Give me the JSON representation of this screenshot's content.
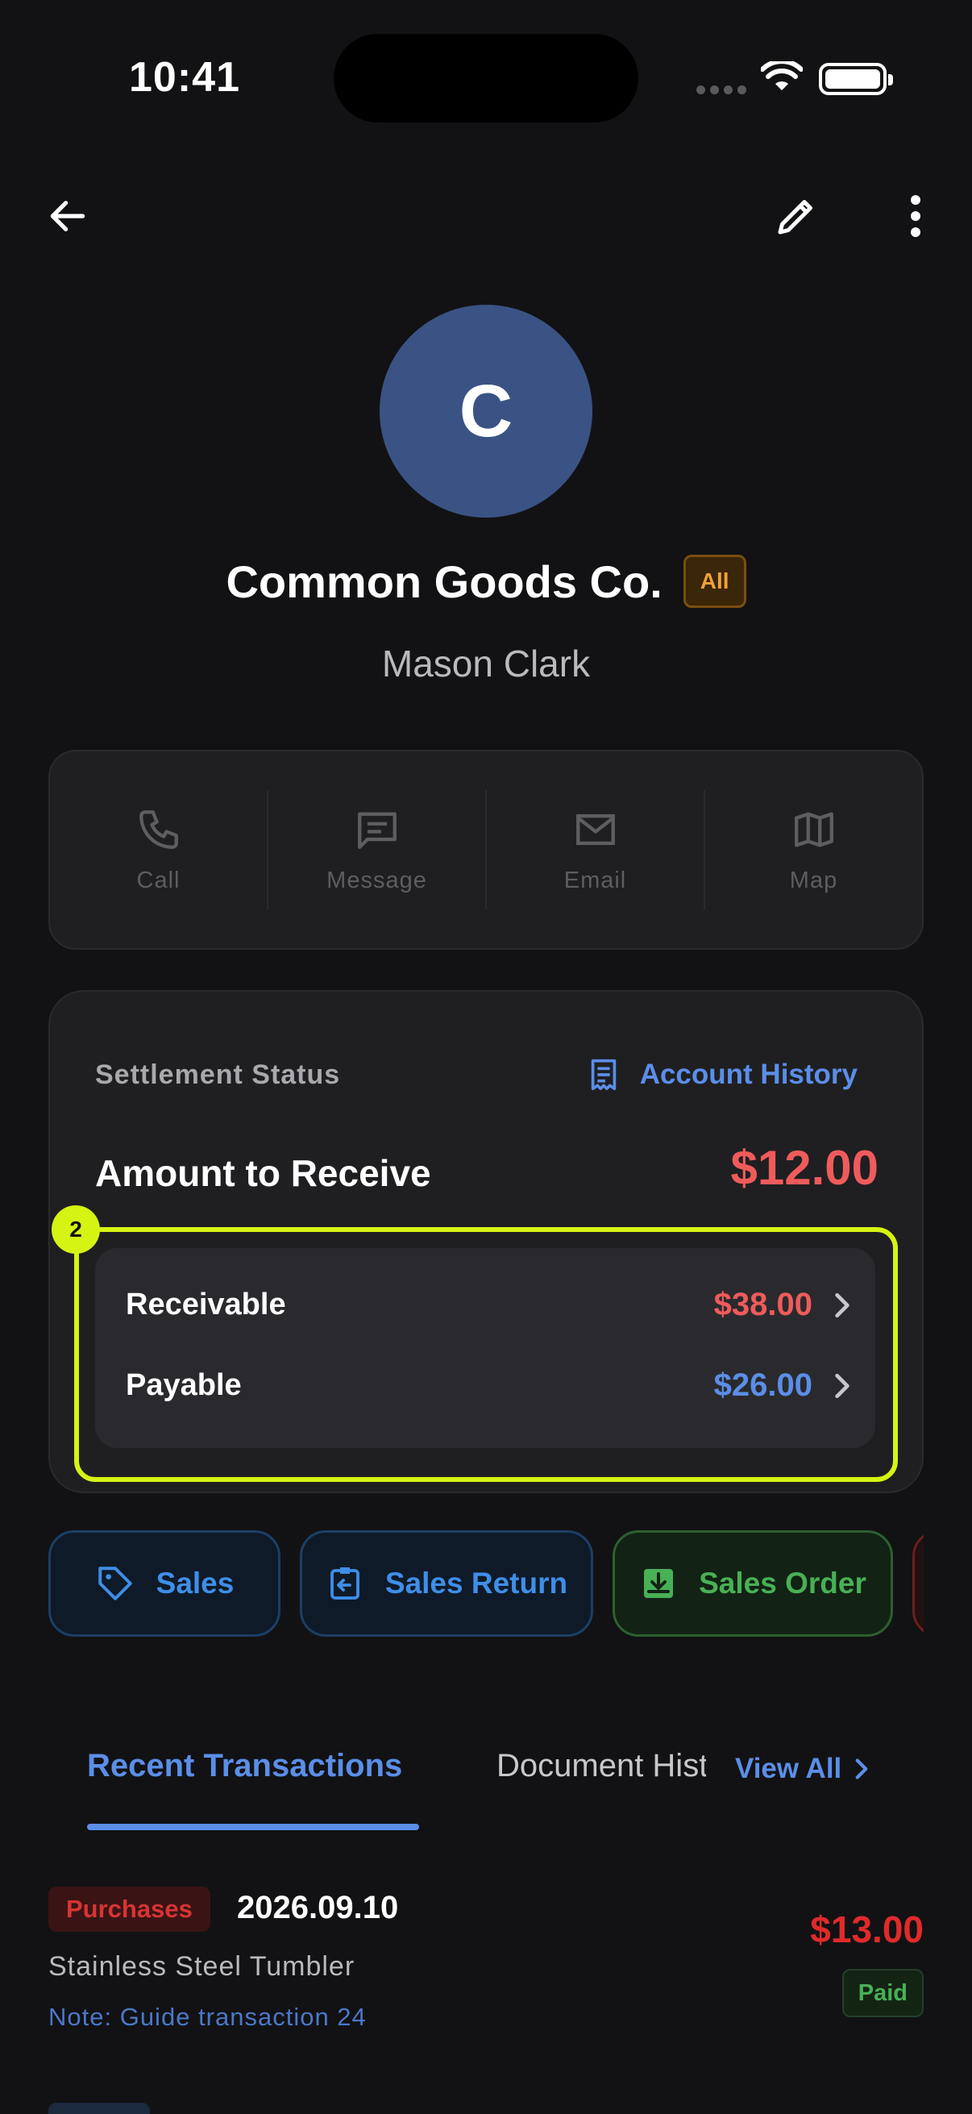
{
  "status_bar": {
    "time": "10:41"
  },
  "header": {
    "back_icon": "arrow-left-icon",
    "edit_icon": "pencil-icon",
    "more_icon": "more-vertical-icon"
  },
  "profile": {
    "avatar_initial": "C",
    "company_name": "Common Goods Co.",
    "badge": "All",
    "contact_name": "Mason Clark"
  },
  "quick_actions": [
    {
      "label": "Call",
      "icon": "phone-icon"
    },
    {
      "label": "Message",
      "icon": "message-icon"
    },
    {
      "label": "Email",
      "icon": "mail-icon"
    },
    {
      "label": "Map",
      "icon": "map-icon"
    }
  ],
  "settlement": {
    "label": "Settlement Status",
    "account_history": "Account History",
    "amount_label": "Amount to Receive",
    "amount_value": "$12.00",
    "receivable_label": "Receivable",
    "receivable_value": "$38.00",
    "payable_label": "Payable",
    "payable_value": "$26.00",
    "highlight_badge": "2"
  },
  "doc_chips": [
    {
      "label": "Sales",
      "icon": "tag-icon"
    },
    {
      "label": "Sales Return",
      "icon": "return-icon"
    },
    {
      "label": "Sales Order",
      "icon": "download-box-icon"
    }
  ],
  "tabs": {
    "recent": "Recent Transactions",
    "document": "Document History",
    "view_all": "View All"
  },
  "transaction": {
    "type": "Purchases",
    "date": "2026.09.10",
    "amount": "$13.00",
    "item": "Stainless Steel Tumbler",
    "note": "Note: Guide transaction 24",
    "status": "Paid"
  },
  "colors": {
    "accent_blue": "#5b8ee8",
    "negative_red": "#ef5b5b",
    "highlight": "#d6f413",
    "avatar_bg": "#3a5384"
  }
}
